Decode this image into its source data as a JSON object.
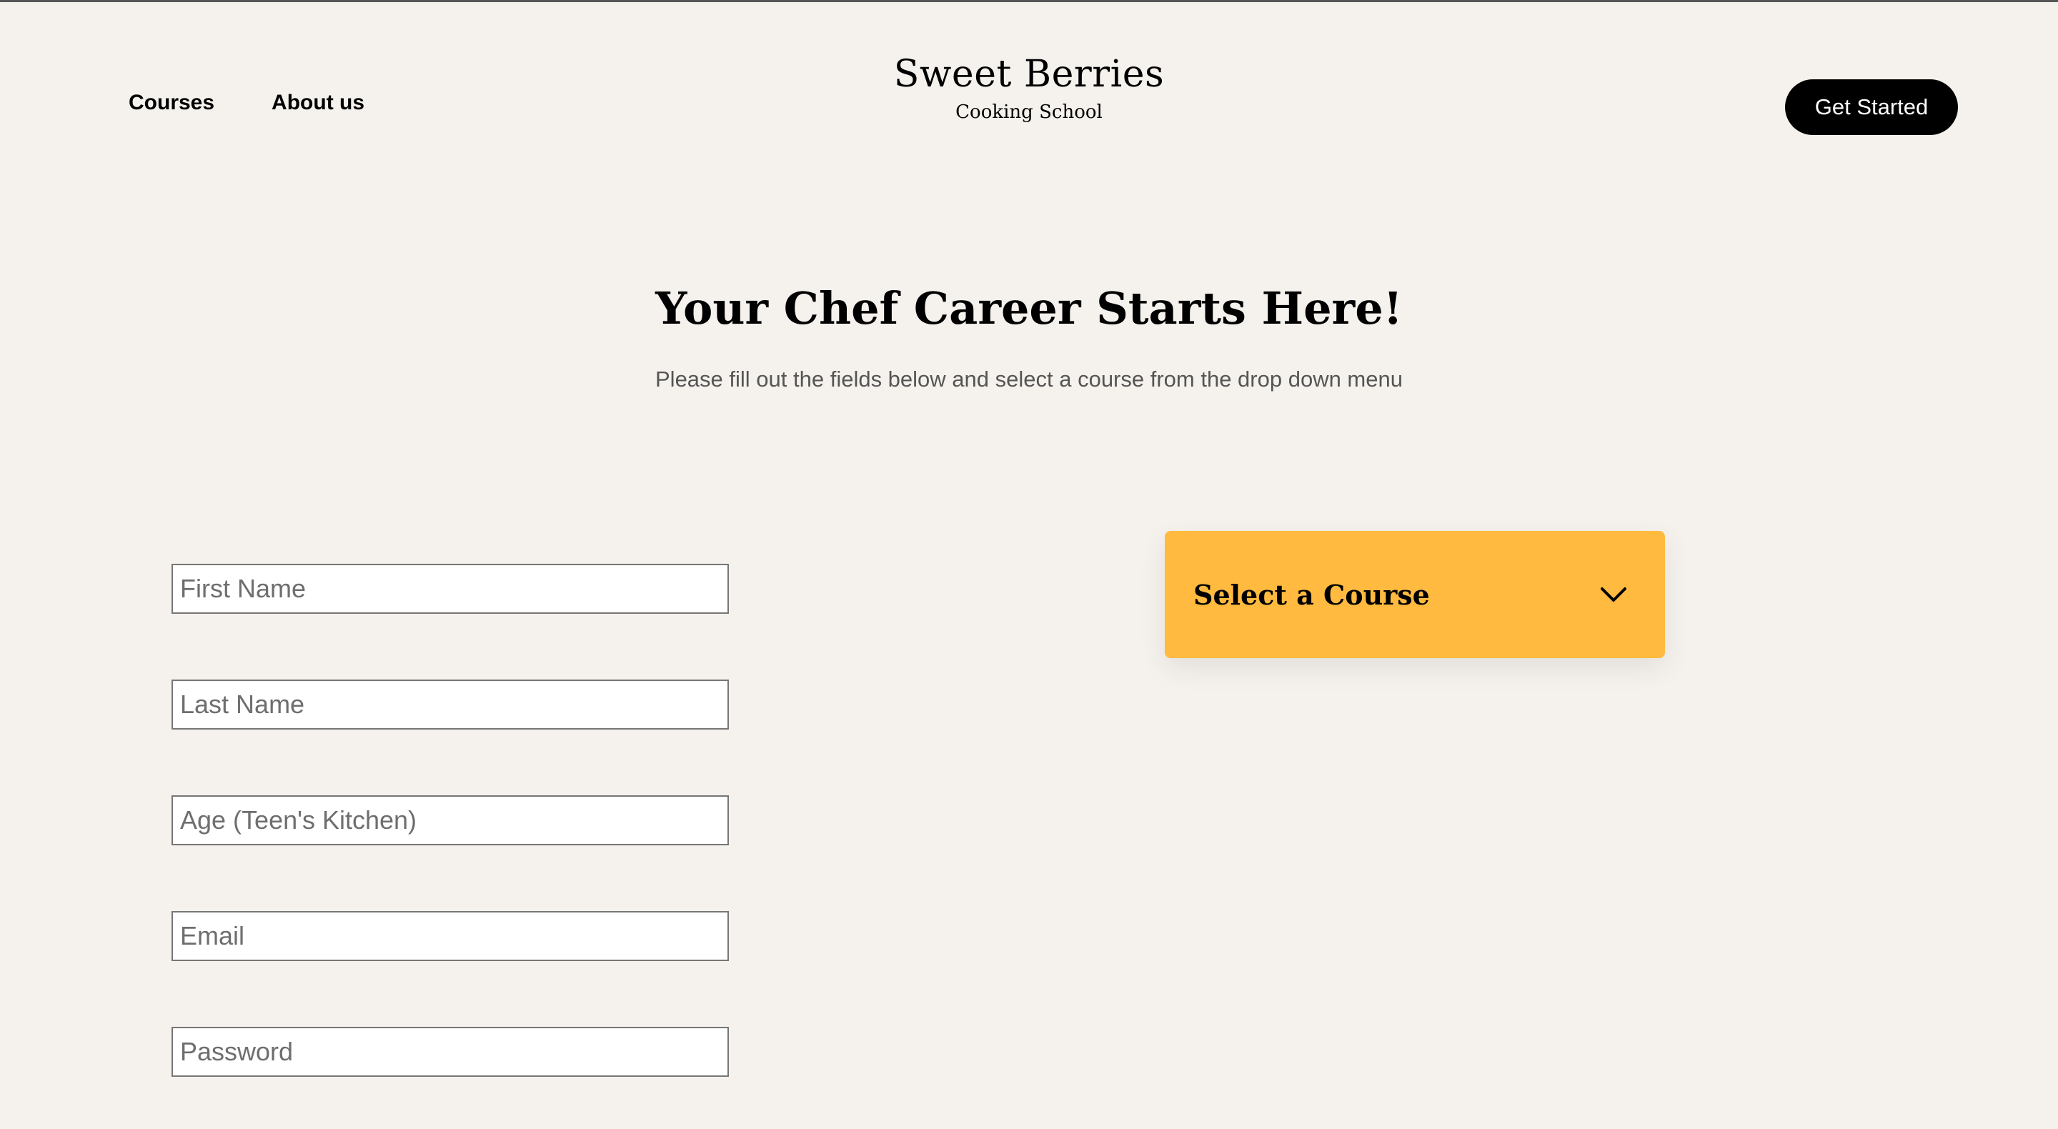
{
  "header": {
    "nav": [
      {
        "label": "Courses"
      },
      {
        "label": "About us"
      }
    ],
    "brand": {
      "title": "Sweet Berries",
      "subtitle": "Cooking School"
    },
    "cta_label": "Get Started"
  },
  "hero": {
    "title": "Your Chef Career Starts Here!",
    "subtitle": "Please fill out the fields below and select a course from the drop down menu"
  },
  "form": {
    "fields": [
      {
        "placeholder": "First Name",
        "value": ""
      },
      {
        "placeholder": "Last Name",
        "value": ""
      },
      {
        "placeholder": "Age (Teen's Kitchen)",
        "value": ""
      },
      {
        "placeholder": "Email",
        "value": ""
      },
      {
        "placeholder": "Password",
        "value": ""
      }
    ]
  },
  "course_select": {
    "label": "Select a Course",
    "icon": "chevron-down-icon"
  },
  "colors": {
    "background": "#f5f2ed",
    "accent": "#ffba3f",
    "cta_bg": "#000000",
    "cta_text": "#ffffff"
  }
}
